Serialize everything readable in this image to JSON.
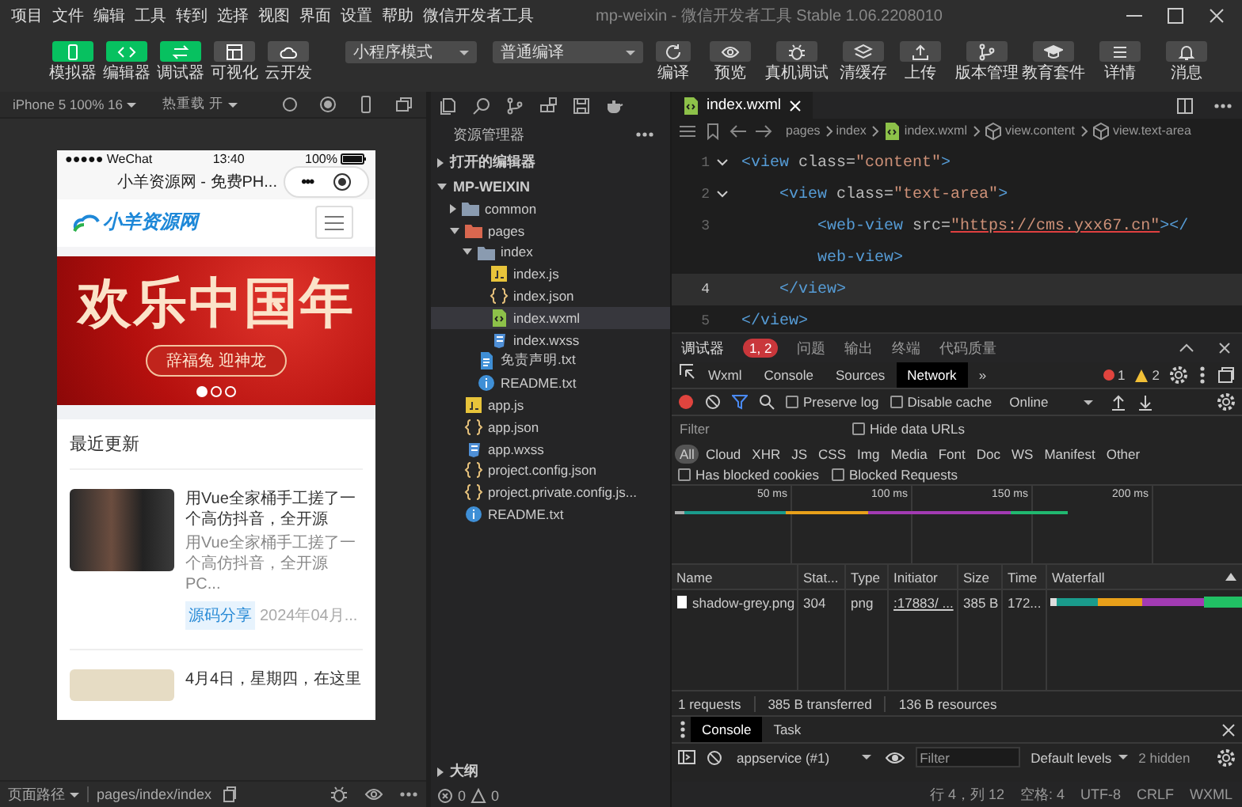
{
  "menu_bar": {
    "items": [
      "项目",
      "文件",
      "编辑",
      "工具",
      "转到",
      "选择",
      "视图",
      "界面",
      "设置",
      "帮助",
      "微信开发者工具"
    ],
    "title": "mp-weixin - 微信开发者工具 Stable 1.06.2208010"
  },
  "toolbar": {
    "mode_buttons": [
      {
        "label": "模拟器",
        "active": true
      },
      {
        "label": "编辑器",
        "active": true
      },
      {
        "label": "调试器",
        "active": true
      },
      {
        "label": "可视化",
        "active": false
      },
      {
        "label": "云开发",
        "active": false
      }
    ],
    "mode_select": "小程序模式",
    "compile_select": "普通编译",
    "compile_actions": [
      {
        "label": "编译"
      },
      {
        "label": "预览"
      },
      {
        "label": "真机调试"
      },
      {
        "label": "清缓存"
      }
    ],
    "right_actions": [
      {
        "label": "上传"
      },
      {
        "label": "版本管理"
      },
      {
        "label": "教育套件"
      },
      {
        "label": "详情"
      },
      {
        "label": "消息"
      }
    ]
  },
  "simulator": {
    "device": "iPhone 5 100% 16",
    "hot_reload": "热重载 开",
    "phone": {
      "carrier": "●●●●● WeChat",
      "time": "13:40",
      "battery": "100%",
      "nav_title": "小羊资源网 - 免费PH...",
      "capsule": "•••",
      "logo": "小羊资源网",
      "banner": {
        "title": "欢乐中国年",
        "subtitle": "辞福兔 迎神龙",
        "dots": [
          {
            "selected": true
          },
          {
            "selected": false
          },
          {
            "selected": false
          }
        ]
      },
      "section_title": "最近更新",
      "articles": [
        {
          "title": "用Vue全家桶手工搓了一个高仿抖音，全开源",
          "summary": "用Vue全家桶手工搓了一个高仿抖音，全开源PC...",
          "tag": "源码分享",
          "date": "2024年04月..."
        },
        {
          "title": "4月4日，星期四，在这里"
        }
      ]
    },
    "path_label": "页面路径",
    "path": "pages/index/index"
  },
  "explorer": {
    "title": "资源管理器",
    "sections": [
      {
        "label": "打开的编辑器",
        "expanded": false
      },
      {
        "label": "MP-WEIXIN",
        "expanded": true
      }
    ],
    "tree": [
      {
        "label": "common",
        "kind": "folder",
        "expanded": false,
        "selected": false
      },
      {
        "label": "pages",
        "kind": "folder-open",
        "expanded": true,
        "selected": false,
        "children": [
          {
            "label": "index",
            "kind": "folder",
            "expanded": true,
            "selected": false,
            "children": [
              {
                "label": "index.js",
                "kind": "js",
                "selected": false
              },
              {
                "label": "index.json",
                "kind": "json",
                "selected": false
              },
              {
                "label": "index.wxml",
                "kind": "wxml",
                "selected": true
              },
              {
                "label": "index.wxss",
                "kind": "wxss",
                "selected": false
              }
            ]
          },
          {
            "label": "免责声明.txt",
            "kind": "txt",
            "selected": false
          },
          {
            "label": "README.txt",
            "kind": "info",
            "selected": false
          }
        ]
      },
      {
        "label": "app.js",
        "kind": "js",
        "selected": false
      },
      {
        "label": "app.json",
        "kind": "json",
        "selected": false
      },
      {
        "label": "app.wxss",
        "kind": "wxss",
        "selected": false
      },
      {
        "label": "project.config.json",
        "kind": "json",
        "selected": false
      },
      {
        "label": "project.private.config.js...",
        "kind": "json",
        "selected": false
      },
      {
        "label": "README.txt",
        "kind": "info",
        "selected": false
      }
    ],
    "outline": {
      "label": "大纲",
      "expanded": false
    },
    "errors": "0",
    "warnings": "0"
  },
  "editor": {
    "tabs": [
      {
        "label": "index.wxml",
        "selected": true
      }
    ],
    "breadcrumb": [
      "pages",
      "index",
      "index.wxml",
      "view.content",
      "view.text-area"
    ],
    "lines": [
      {
        "number": "1",
        "foldable": true,
        "current": false,
        "rows": [
          [
            {
              "kind": "tag",
              "text": "<view"
            },
            {
              "kind": "attr",
              "text": " class="
            },
            {
              "kind": "string",
              "text": "\"content\""
            },
            {
              "kind": "tag",
              "text": ">"
            }
          ]
        ]
      },
      {
        "number": "2",
        "foldable": true,
        "current": false,
        "rows": [
          [
            {
              "kind": "space",
              "text": "    "
            },
            {
              "kind": "tag",
              "text": "<view"
            },
            {
              "kind": "attr",
              "text": " class="
            },
            {
              "kind": "string",
              "text": "\"text-area\""
            },
            {
              "kind": "tag",
              "text": ">"
            }
          ]
        ]
      },
      {
        "number": "3",
        "foldable": false,
        "current": false,
        "rows": [
          [
            {
              "kind": "space",
              "text": "        "
            },
            {
              "kind": "tag",
              "text": "<web-view"
            },
            {
              "kind": "attr",
              "text": " src="
            },
            {
              "kind": "link",
              "text": "\"https://cms.yxx67.cn\""
            },
            {
              "kind": "tag",
              "text": "></"
            }
          ],
          [
            {
              "kind": "space",
              "text": "        "
            },
            {
              "kind": "tag",
              "text": "web-view>"
            }
          ]
        ]
      },
      {
        "number": "4",
        "foldable": false,
        "current": true,
        "rows": [
          [
            {
              "kind": "space",
              "text": "    "
            },
            {
              "kind": "tag",
              "text": "</view>"
            }
          ]
        ]
      },
      {
        "number": "5",
        "foldable": false,
        "current": false,
        "rows": [
          [
            {
              "kind": "tag",
              "text": "</view>"
            }
          ]
        ]
      }
    ]
  },
  "devtools": {
    "panel_tabs": [
      {
        "label": "调试器",
        "selected": true,
        "badge": "1, 2"
      },
      {
        "label": "问题",
        "selected": false
      },
      {
        "label": "输出",
        "selected": false
      },
      {
        "label": "终端",
        "selected": false
      },
      {
        "label": "代码质量",
        "selected": false
      }
    ],
    "tabs": [
      {
        "label": "Wxml",
        "selected": false
      },
      {
        "label": "Console",
        "selected": false
      },
      {
        "label": "Sources",
        "selected": false
      },
      {
        "label": "Network",
        "selected": true
      }
    ],
    "more": "»",
    "errors": "1",
    "warnings": "2",
    "network": {
      "preserve_log": {
        "label": "Preserve log",
        "checked": false
      },
      "disable_cache": {
        "label": "Disable cache",
        "checked": false
      },
      "throttle": "Online",
      "filter_placeholder": "Filter",
      "hide_data_urls": {
        "label": "Hide data URLs",
        "checked": false
      },
      "types": [
        {
          "label": "All",
          "selected": true
        },
        {
          "label": "Cloud",
          "selected": false
        },
        {
          "label": "XHR",
          "selected": false
        },
        {
          "label": "JS",
          "selected": false
        },
        {
          "label": "CSS",
          "selected": false
        },
        {
          "label": "Img",
          "selected": false
        },
        {
          "label": "Media",
          "selected": false
        },
        {
          "label": "Font",
          "selected": false
        },
        {
          "label": "Doc",
          "selected": false
        },
        {
          "label": "WS",
          "selected": false
        },
        {
          "label": "Manifest",
          "selected": false
        },
        {
          "label": "Other",
          "selected": false
        }
      ],
      "blocked_cookies": {
        "label": "Has blocked cookies",
        "checked": false
      },
      "blocked_requests": {
        "label": "Blocked Requests",
        "checked": false
      },
      "timeline_ticks": [
        "50 ms",
        "100 ms",
        "150 ms",
        "200 ms"
      ],
      "columns": [
        "Name",
        "Stat...",
        "Type",
        "Initiator",
        "Size",
        "Time",
        "Waterfall"
      ],
      "rows": [
        {
          "cells": [
            "shadow-grey.png",
            "304",
            "png",
            ":17883/ ...",
            "385 B",
            "172..."
          ]
        }
      ],
      "summary": [
        "1 requests",
        "385 B transferred",
        "136 B resources"
      ]
    },
    "drawer": {
      "tabs": [
        {
          "label": "Console",
          "selected": true
        },
        {
          "label": "Task",
          "selected": false
        }
      ],
      "context": "appservice (#1)",
      "filter_placeholder": "Filter",
      "levels": "Default levels",
      "hidden": "2 hidden"
    }
  },
  "status_bar": [
    "行 4，列 12",
    "空格: 4",
    "UTF-8",
    "CRLF",
    "WXML"
  ]
}
